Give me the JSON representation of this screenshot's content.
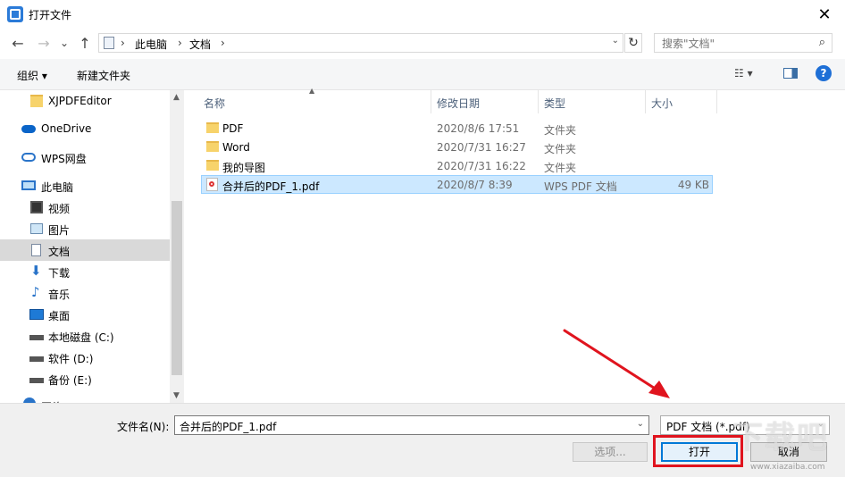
{
  "window": {
    "title": "打开文件",
    "close_glyph": "✕"
  },
  "nav_buttons": {
    "back": "←",
    "forward": "→",
    "recent": "⌄",
    "up": "↑"
  },
  "address": {
    "sep": "›",
    "crumbs": [
      "此电脑",
      "文档"
    ],
    "dropdown": "⌄",
    "refresh": "↻"
  },
  "search": {
    "placeholder": "搜索\"文档\"",
    "icon": "⌕"
  },
  "toolbar": {
    "organize_label": "组织 ▾",
    "new_folder_label": "新建文件夹",
    "view_label": "☷ ▾",
    "help": "?"
  },
  "nav_pane": {
    "items": [
      {
        "label": "XJPDFEditor",
        "icon": "folder-icon"
      },
      {
        "label": "OneDrive",
        "icon": "cloud-icon"
      },
      {
        "label": "WPS网盘",
        "icon": "cloud-outline-icon"
      },
      {
        "label": "此电脑",
        "icon": "computer-icon"
      },
      {
        "label": "视频",
        "icon": "video-icon"
      },
      {
        "label": "图片",
        "icon": "picture-icon"
      },
      {
        "label": "文档",
        "icon": "document-icon",
        "selected": true
      },
      {
        "label": "下载",
        "icon": "download-icon"
      },
      {
        "label": "音乐",
        "icon": "music-icon"
      },
      {
        "label": "桌面",
        "icon": "desktop-icon"
      },
      {
        "label": "本地磁盘 (C:)",
        "icon": "drive-c-icon"
      },
      {
        "label": "软件 (D:)",
        "icon": "drive-icon"
      },
      {
        "label": "备份 (E:)",
        "icon": "drive-icon"
      },
      {
        "label": "网络",
        "icon": "network-icon"
      }
    ],
    "scroll_up": "▲",
    "scroll_down": "▼"
  },
  "columns": {
    "name": "名称",
    "date": "修改日期",
    "type": "类型",
    "size": "大小",
    "sort_glyph": "▲"
  },
  "files": [
    {
      "name": "PDF",
      "date": "2020/8/6 17:51",
      "type": "文件夹",
      "size": "",
      "kind": "folder"
    },
    {
      "name": "Word",
      "date": "2020/7/31 16:27",
      "type": "文件夹",
      "size": "",
      "kind": "folder"
    },
    {
      "name": "我的导图",
      "date": "2020/7/31 16:22",
      "type": "文件夹",
      "size": "",
      "kind": "folder"
    },
    {
      "name": "合并后的PDF_1.pdf",
      "date": "2020/8/7 8:39",
      "type": "WPS PDF 文档",
      "size": "49 KB",
      "kind": "pdf",
      "selected": true
    }
  ],
  "bottom": {
    "filename_label": "文件名(N):",
    "filename_value": "合并后的PDF_1.pdf",
    "filetype_value": "PDF 文档 (*.pdf)",
    "options_label": "选项...",
    "open_label": "打开",
    "cancel_label": "取消",
    "dropdown": "⌄"
  },
  "watermark": {
    "text": "下载吧",
    "sub": "www.xiazaiba.com"
  },
  "colors": {
    "accent": "#0078d7",
    "highlight_red": "#e0141e",
    "selection": "#cce8ff"
  }
}
